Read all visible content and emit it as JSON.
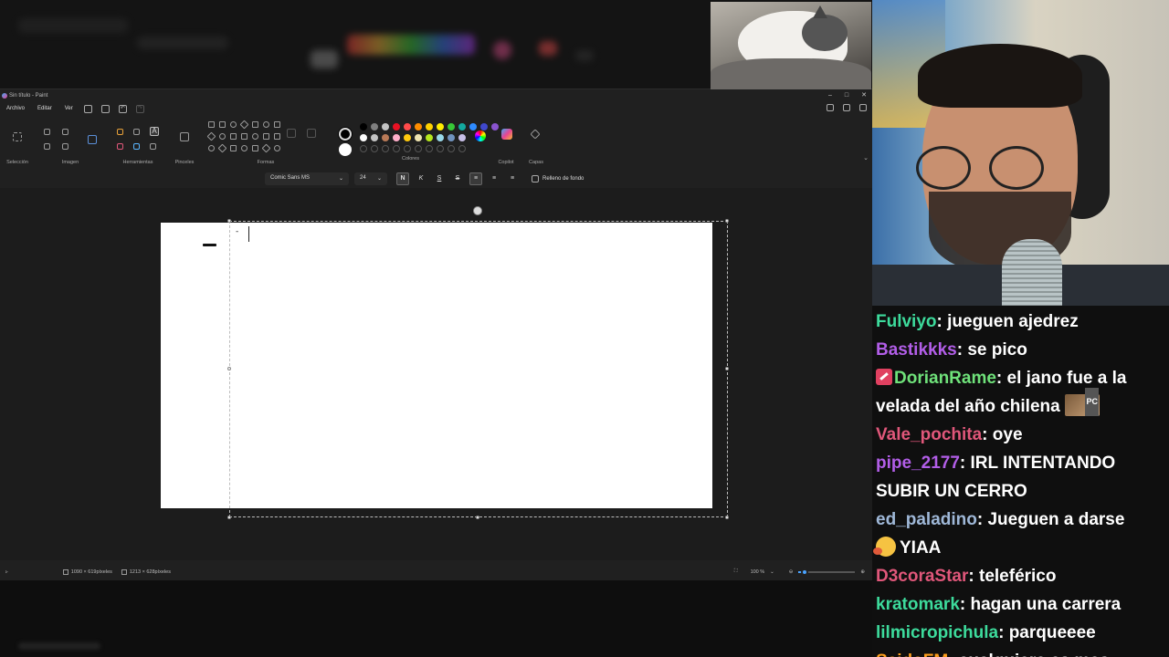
{
  "paint": {
    "window_title": "Sin título - Paint",
    "window_controls": [
      "–",
      "□",
      "✕"
    ],
    "menu": [
      "Archivo",
      "Editar",
      "Ver"
    ],
    "groups": {
      "seleccion": "Selección",
      "imagen": "Imagen",
      "herramientas": "Herramientas",
      "pinceles": "Pinceles",
      "formas": "Formas",
      "colores": "Colores",
      "copilot": "Copilot",
      "capas": "Capas"
    },
    "palette_row1": [
      "#000000",
      "#7f7f7f",
      "#c3c3c3",
      "#e81123",
      "#ff4b4b",
      "#ff8c00",
      "#ffd200",
      "#ffee00",
      "#37c837",
      "#13a89e",
      "#2e8bff",
      "#3f48cc",
      "#8a54cf"
    ],
    "palette_row2": [
      "#ffffff",
      "#c3c3c3",
      "#b97a57",
      "#ffaec9",
      "#ffc90e",
      "#efe4b0",
      "#b5e61d",
      "#99d9ea",
      "#7092be",
      "#c8bfe7"
    ],
    "primary_color": "#000000",
    "secondary_color": "#ffffff",
    "text_toolbar": {
      "font": "Comic Sans MS",
      "size": "24",
      "bold": "N",
      "italic": "K",
      "underline": "S",
      "strike": "S",
      "fill_label": "Relleno de fondo"
    },
    "canvas_text": "-",
    "status": {
      "cursor": "1090 × 619píxeles",
      "selection": "1213 × 628píxeles",
      "zoom": "100 %",
      "zoom_fraction": 0.1
    }
  },
  "chat": {
    "messages": [
      {
        "user": "Fulviyo",
        "color": "#3ddb9c",
        "text": "jueguen ajedrez"
      },
      {
        "user": "Bastikkks",
        "color": "#b25ee8",
        "text": "se pico"
      },
      {
        "user": "DorianRame",
        "color": "#6fe27a",
        "text": "el jano fue a la",
        "badge": "rocket-badge"
      },
      {
        "user": "",
        "color": "#ffffff",
        "text": "velada del año chilena",
        "emote": "PC"
      },
      {
        "user": "Vale_pochita",
        "color": "#e0577a",
        "text": "oye"
      },
      {
        "user": "pipe_2177",
        "color": "#b25ee8",
        "text": "IRL INTENTANDO"
      },
      {
        "user": "",
        "color": "#ffffff",
        "text": "SUBIR UN CERRO"
      },
      {
        "user": "ed_paladino",
        "color": "#9fb8d8",
        "text": "Jueguen a darse"
      },
      {
        "user": "",
        "color": "#ffffff",
        "text": "YIAA",
        "face": true
      },
      {
        "user": "D3coraStar",
        "color": "#e0577a",
        "text": "teleférico"
      },
      {
        "user": "kratomark",
        "color": "#3ddb9c",
        "text": "hagan una carrera"
      },
      {
        "user": "lilmicropichula",
        "color": "#3ddb9c",
        "text": "parqueeee"
      },
      {
        "user": "SaidoFM",
        "color": "#ff9f1c",
        "text": "cualquiera es mas"
      }
    ]
  }
}
